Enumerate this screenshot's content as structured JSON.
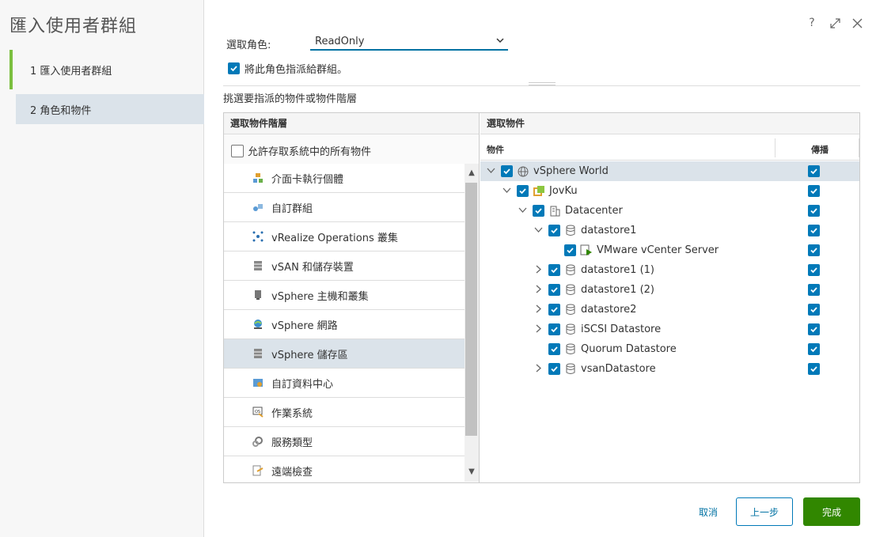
{
  "wizard": {
    "title": "匯入使用者群組",
    "steps": [
      {
        "label": "1 匯入使用者群組"
      },
      {
        "label": "2 角色和物件"
      }
    ]
  },
  "header": {
    "help_icon": "?"
  },
  "role": {
    "label": "選取角色:",
    "value": "ReadOnly",
    "assign_label": "將此角色指派給群組。"
  },
  "hint": "挑選要指派的物件或物件階層",
  "left_pane": {
    "title": "選取物件階層",
    "all_objects_label": "允許存取系統中的所有物件",
    "items": [
      {
        "label": "介面卡執行個體",
        "icon": "adapter-icon"
      },
      {
        "label": "自訂群組",
        "icon": "custom-group-icon"
      },
      {
        "label": "vRealize Operations 叢集",
        "icon": "cluster-icon"
      },
      {
        "label": "vSAN 和儲存裝置",
        "icon": "storage-icon"
      },
      {
        "label": "vSphere 主機和叢集",
        "icon": "host-icon"
      },
      {
        "label": "vSphere 網路",
        "icon": "network-icon"
      },
      {
        "label": "vSphere 儲存區",
        "icon": "datastore-icon"
      },
      {
        "label": "自訂資料中心",
        "icon": "datacenter-icon"
      },
      {
        "label": "作業系統",
        "icon": "os-icon"
      },
      {
        "label": "服務類型",
        "icon": "service-icon"
      },
      {
        "label": "遠端檢查",
        "icon": "remote-check-icon"
      }
    ]
  },
  "right_pane": {
    "title": "選取物件",
    "col_object": "物件",
    "col_propagate": "傳播",
    "tree": [
      {
        "label": "vSphere World",
        "icon": "globe-icon",
        "toggle": "down"
      },
      {
        "label": "JovKu",
        "icon": "vcenter-icon",
        "toggle": "down"
      },
      {
        "label": "Datacenter",
        "icon": "datacenter-icon",
        "toggle": "down"
      },
      {
        "label": "datastore1",
        "icon": "datastore-icon",
        "toggle": "down"
      },
      {
        "label": "VMware vCenter Server",
        "icon": "vm-icon",
        "toggle": "none"
      },
      {
        "label": "datastore1 (1)",
        "icon": "datastore-icon",
        "toggle": "right"
      },
      {
        "label": "datastore1 (2)",
        "icon": "datastore-icon",
        "toggle": "right"
      },
      {
        "label": "datastore2",
        "icon": "datastore-icon",
        "toggle": "right"
      },
      {
        "label": "iSCSI Datastore",
        "icon": "datastore-icon",
        "toggle": "right"
      },
      {
        "label": "Quorum Datastore",
        "icon": "datastore-icon",
        "toggle": "none"
      },
      {
        "label": "vsanDatastore",
        "icon": "datastore-icon",
        "toggle": "right"
      }
    ]
  },
  "footer": {
    "cancel": "取消",
    "back": "上一步",
    "finish": "完成"
  },
  "colors": {
    "accent": "#0079b8",
    "finish": "#318700",
    "active_step": "#7bbf3f",
    "selected_row": "#dbe3ea"
  }
}
